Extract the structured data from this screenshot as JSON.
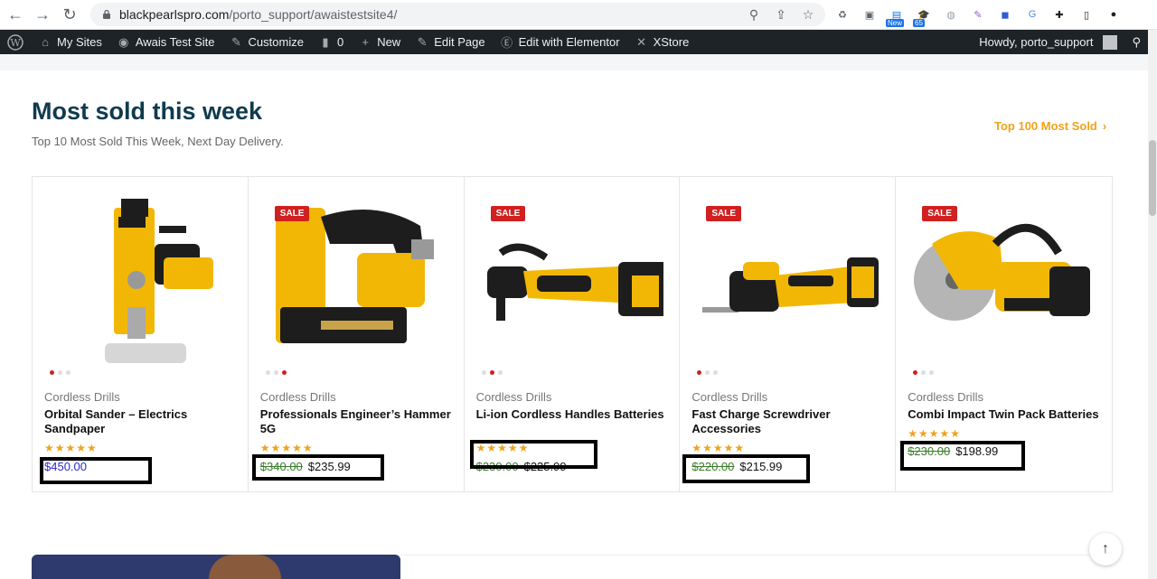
{
  "browser": {
    "url_host": "blackpearlspro.com",
    "url_path": "/porto_support/awaistestsite4/",
    "extensions": [
      {
        "name": "recycle-ext-icon",
        "color": "#5f6368",
        "glyph": "♻"
      },
      {
        "name": "camera-ext-icon",
        "color": "#5f6368",
        "glyph": "▣"
      },
      {
        "name": "new-ext-icon",
        "color": "#1a73e8",
        "glyph": "▤",
        "badge": "New"
      },
      {
        "name": "grad-ext-icon",
        "color": "#6b3fa0",
        "glyph": "🎓",
        "badge": "65"
      },
      {
        "name": "globe-ext-icon",
        "color": "#9aa0a6",
        "glyph": "◍"
      },
      {
        "name": "pen-ext-icon",
        "color": "#8e5cd9",
        "glyph": "✎"
      },
      {
        "name": "video-ext-icon",
        "color": "#2d5bd6",
        "glyph": "◼"
      },
      {
        "name": "translate-ext-icon",
        "color": "#4a8af4",
        "glyph": "G"
      },
      {
        "name": "puzzle-ext-icon",
        "color": "#202124",
        "glyph": "✚"
      },
      {
        "name": "sidebar-ext-icon",
        "color": "#202124",
        "glyph": "▯"
      },
      {
        "name": "profile-ext-icon",
        "color": "#202124",
        "glyph": "●"
      }
    ]
  },
  "adminbar": {
    "items": [
      {
        "label": "My Sites",
        "icon": "home"
      },
      {
        "label": "Awais Test Site",
        "icon": "palette"
      },
      {
        "label": "Customize",
        "icon": "brush"
      },
      {
        "label": "0",
        "icon": "comment"
      },
      {
        "label": "New",
        "icon": "plus"
      },
      {
        "label": "Edit Page",
        "icon": "pencil"
      },
      {
        "label": "Edit with Elementor",
        "icon": "elementor"
      },
      {
        "label": "XStore",
        "icon": "xstore"
      }
    ],
    "greeting": "Howdy, porto_support"
  },
  "section": {
    "title": "Most sold this week",
    "subtitle": "Top 10 Most Sold This Week, Next Day Delivery.",
    "link": "Top 100 Most Sold"
  },
  "products": [
    {
      "category": "Cordless Drills",
      "name": "Orbital Sander – Electrics Sandpaper",
      "sale": "",
      "old_price": "",
      "price": "$450.00",
      "rating": 5,
      "dots": 3,
      "active_dot": 0
    },
    {
      "category": "Cordless Drills",
      "name": "Professionals Engineer’s Hammer 5G",
      "sale": "SALE",
      "old_price": "$340.00",
      "price": "$235.99",
      "rating": 5,
      "dots": 3,
      "active_dot": 2
    },
    {
      "category": "Cordless Drills",
      "name": "Li-ion Cordless Handles Batteries",
      "sale": "SALE",
      "old_price": "$230.00",
      "price": "$225.99",
      "rating": 5,
      "dots": 3,
      "active_dot": 1
    },
    {
      "category": "Cordless Drills",
      "name": "Fast Charge Screwdriver Accessories",
      "sale": "SALE",
      "old_price": "$220.00",
      "price": "$215.99",
      "rating": 5,
      "dots": 3,
      "active_dot": 0
    },
    {
      "category": "Cordless Drills",
      "name": "Combi Impact Twin Pack Batteries",
      "sale": "SALE",
      "old_price": "$230.00",
      "price": "$198.99",
      "rating": 5,
      "dots": 3,
      "active_dot": 0
    }
  ],
  "colors": {
    "title": "#0f3b4f",
    "accent": "#f0a21b",
    "sale": "#d12020",
    "old_price": "#3a7d2a",
    "tool_yellow": "#f2b705",
    "tool_black": "#1d1d1d"
  }
}
